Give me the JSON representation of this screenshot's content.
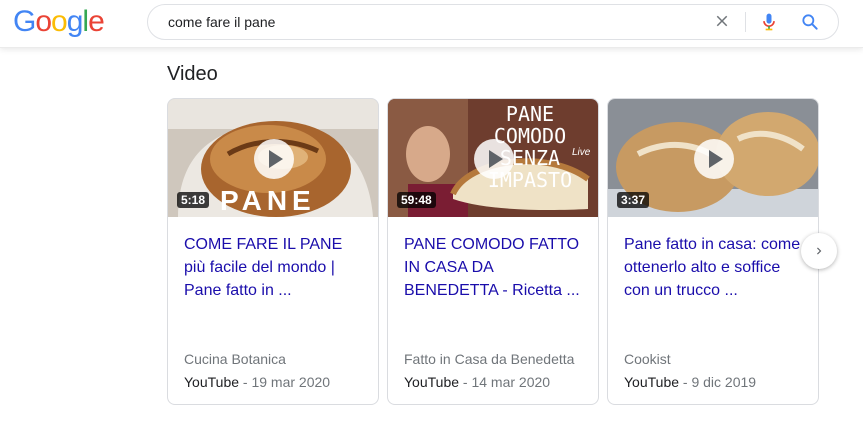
{
  "header": {
    "logo_letters": [
      "G",
      "o",
      "o",
      "g",
      "l",
      "e"
    ],
    "logo_colors": [
      "#4285F4",
      "#EA4335",
      "#FBBC05",
      "#4285F4",
      "#34A853",
      "#EA4335"
    ],
    "search_query": "come fare il pane"
  },
  "section": {
    "title": "Video"
  },
  "cards": [
    {
      "duration": "5:18",
      "thumb_overlay": "PANE",
      "title": "COME FARE IL PANE più facile del mondo | Pane fatto in ...",
      "channel": "Cucina Botanica",
      "source": "YouTube",
      "date": " - 19 mar 2020"
    },
    {
      "duration": "59:48",
      "thumb_overlay": "PANE COMODO SENZA IMPASTO",
      "thumb_live": "Live",
      "title": "PANE COMODO FATTO IN CASA DA BENEDETTA - Ricetta ...",
      "channel": "Fatto in Casa da Benedetta",
      "source": "YouTube",
      "date": " - 14 mar 2020"
    },
    {
      "duration": "3:37",
      "title": "Pane fatto in casa: come ottenerlo alto e soffice con un trucco ...",
      "channel": "Cookist",
      "source": "YouTube",
      "date": " - 9 dic 2019"
    }
  ],
  "icons": {
    "clear": "close-icon",
    "mic": "microphone-icon",
    "search": "search-icon",
    "next": "chevron-right-icon",
    "play": "play-icon"
  }
}
